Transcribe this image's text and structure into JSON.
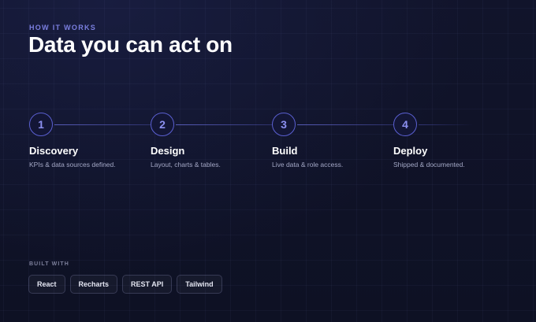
{
  "header": {
    "eyebrow": "HOW IT WORKS",
    "title": "Data you can act on"
  },
  "steps": [
    {
      "number": "1",
      "title": "Discovery",
      "description": "KPIs & data sources defined."
    },
    {
      "number": "2",
      "title": "Design",
      "description": "Layout, charts & tables."
    },
    {
      "number": "3",
      "title": "Build",
      "description": "Live data & role access."
    },
    {
      "number": "4",
      "title": "Deploy",
      "description": "Shipped & documented."
    }
  ],
  "built_with": {
    "label": "BUILT WITH",
    "chips": [
      "React",
      "Recharts",
      "REST API",
      "Tailwind"
    ]
  },
  "colors": {
    "background": "#0f1226",
    "accent": "#7b7fe0",
    "circle_border": "#5a5fd0"
  }
}
